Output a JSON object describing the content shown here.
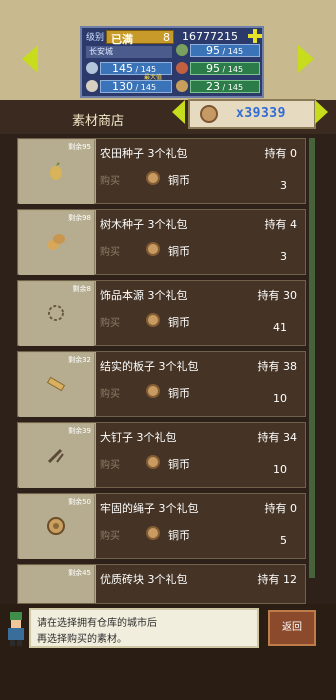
{
  "header": {
    "level_label": "级别",
    "level_status": "已满",
    "level_number": "8",
    "money": "16777215",
    "city": "长安城",
    "stats": [
      {
        "value": "95",
        "max": "145"
      },
      {
        "value": "145",
        "max": "145",
        "tag": "最大值"
      },
      {
        "value": "95",
        "max": "145"
      },
      {
        "value": "130",
        "max": "145"
      },
      {
        "value": "23",
        "max": "145"
      }
    ]
  },
  "shop": {
    "title": "素材商店",
    "stock": "x39339"
  },
  "items": [
    {
      "remain": "剩余95",
      "name": "农田种子 3个礼包",
      "own": "持有 0",
      "buy": "购买",
      "currency": "铜币",
      "price": "3",
      "icon": "seed-icon"
    },
    {
      "remain": "剩余98",
      "name": "树木种子 3个礼包",
      "own": "持有 4",
      "buy": "购买",
      "currency": "铜币",
      "price": "3",
      "icon": "wood-seed-icon"
    },
    {
      "remain": "剩余8",
      "name": "饰品本源 3个礼包",
      "own": "持有 30",
      "buy": "购买",
      "currency": "铜币",
      "price": "41",
      "icon": "ornament-icon"
    },
    {
      "remain": "剩余32",
      "name": "结实的板子 3个礼包",
      "own": "持有 38",
      "buy": "购买",
      "currency": "铜币",
      "price": "10",
      "icon": "board-icon"
    },
    {
      "remain": "剩余39",
      "name": "大钉子 3个礼包",
      "own": "持有 34",
      "buy": "购买",
      "currency": "铜币",
      "price": "10",
      "icon": "nail-icon"
    },
    {
      "remain": "剩余50",
      "name": "牢固的绳子 3个礼包",
      "own": "持有 0",
      "buy": "购买",
      "currency": "铜币",
      "price": "5",
      "icon": "rope-icon"
    },
    {
      "remain": "剩余45",
      "name": "优质砖块 3个礼包",
      "own": "持有 12",
      "buy": "",
      "currency": "",
      "price": "",
      "icon": "brick-icon"
    }
  ],
  "dialog": {
    "line1": "请在选择拥有仓库的城市后",
    "line2": "再选择购买的素材。"
  },
  "back_label": "返回"
}
